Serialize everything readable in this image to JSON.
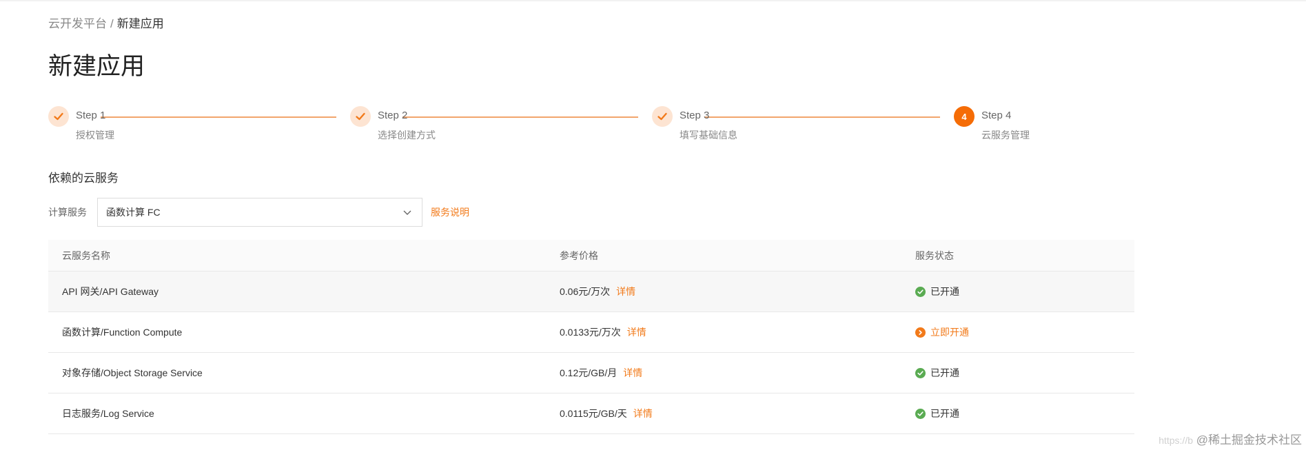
{
  "breadcrumb": {
    "parent": "云开发平台",
    "separator": "/",
    "current": "新建应用"
  },
  "page_title": "新建应用",
  "steps": [
    {
      "title": "Step 1",
      "desc": "授权管理",
      "status": "done"
    },
    {
      "title": "Step 2",
      "desc": "选择创建方式",
      "status": "done"
    },
    {
      "title": "Step 3",
      "desc": "填写基础信息",
      "status": "done"
    },
    {
      "title": "Step 4",
      "desc": "云服务管理",
      "status": "active",
      "number": "4"
    }
  ],
  "section_title": "依赖的云服务",
  "form": {
    "label": "计算服务",
    "select_value": "函数计算 FC",
    "service_link": "服务说明"
  },
  "table": {
    "headers": [
      "云服务名称",
      "参考价格",
      "服务状态"
    ],
    "rows": [
      {
        "name": "API 网关/API Gateway",
        "price": "0.06元/万次",
        "detail": "详情",
        "status": "已开通",
        "status_type": "ok"
      },
      {
        "name": "函数计算/Function Compute",
        "price": "0.0133元/万次",
        "detail": "详情",
        "status": "立即开通",
        "status_type": "open"
      },
      {
        "name": "对象存储/Object Storage Service",
        "price": "0.12元/GB/月",
        "detail": "详情",
        "status": "已开通",
        "status_type": "ok"
      },
      {
        "name": "日志服务/Log Service",
        "price": "0.0115元/GB/天",
        "detail": "详情",
        "status": "已开通",
        "status_type": "ok"
      }
    ]
  },
  "watermark": {
    "url": "https://b",
    "text": "@稀土掘金技术社区"
  },
  "colors": {
    "accent": "#f27a1a",
    "success": "#5aab52",
    "step_done_bg": "#fde4d2"
  }
}
